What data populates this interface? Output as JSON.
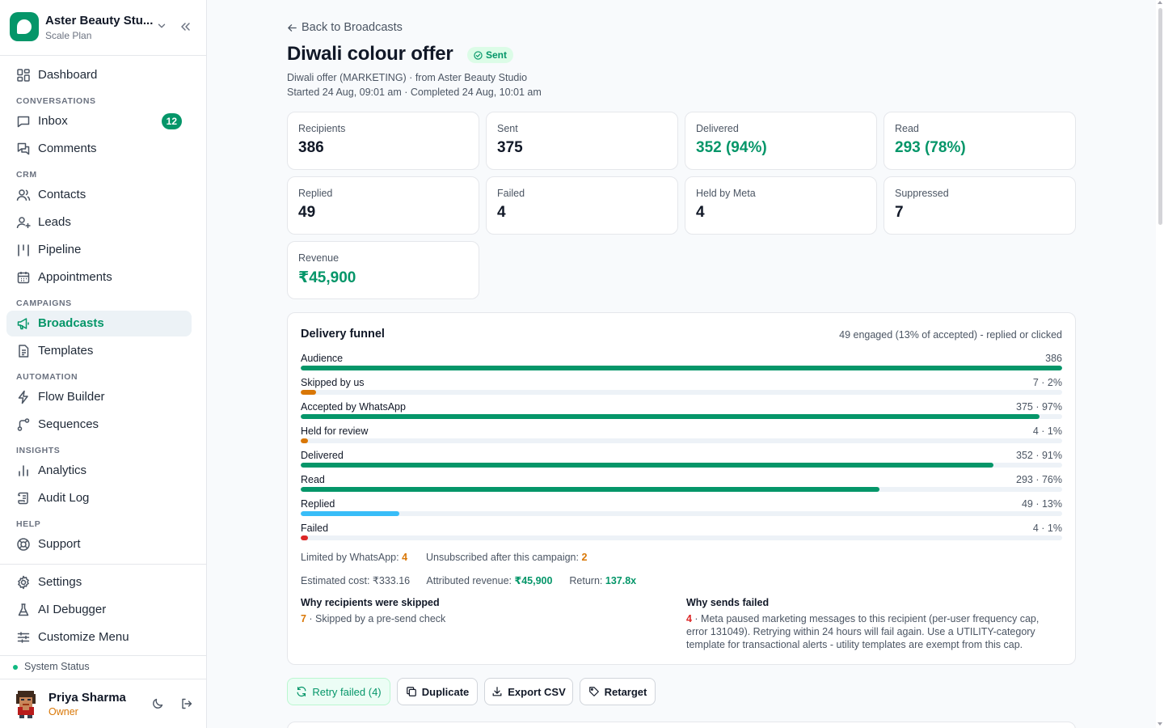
{
  "workspace": {
    "name": "Aster Beauty Stu...",
    "plan": "Scale Plan"
  },
  "sidebar": {
    "dashboard": "Dashboard",
    "sections": {
      "conversations": "CONVERSATIONS",
      "crm": "CRM",
      "campaigns": "CAMPAIGNS",
      "automation": "AUTOMATION",
      "insights": "INSIGHTS",
      "help": "HELP"
    },
    "items": {
      "inbox": "Inbox",
      "inbox_badge": "12",
      "comments": "Comments",
      "contacts": "Contacts",
      "leads": "Leads",
      "pipeline": "Pipeline",
      "appointments": "Appointments",
      "broadcasts": "Broadcasts",
      "templates": "Templates",
      "flow_builder": "Flow Builder",
      "sequences": "Sequences",
      "analytics": "Analytics",
      "audit_log": "Audit Log",
      "support": "Support",
      "settings": "Settings",
      "ai_debugger": "AI Debugger",
      "customize_menu": "Customize Menu"
    },
    "system_status": "System Status",
    "user": {
      "name": "Priya Sharma",
      "role": "Owner"
    }
  },
  "header": {
    "back": "Back to Broadcasts",
    "title": "Diwali colour offer",
    "status": "Sent",
    "meta1": "Diwali offer (MARKETING) · from Aster Beauty Studio",
    "meta2": "Started 24 Aug, 09:01 am · Completed 24 Aug, 10:01 am"
  },
  "stats": [
    {
      "label": "Recipients",
      "value": "386"
    },
    {
      "label": "Sent",
      "value": "375"
    },
    {
      "label": "Delivered",
      "value": "352 (94%)"
    },
    {
      "label": "Read",
      "value": "293 (78%)"
    },
    {
      "label": "Replied",
      "value": "49"
    },
    {
      "label": "Failed",
      "value": "4"
    },
    {
      "label": "Held by Meta",
      "value": "4"
    },
    {
      "label": "Suppressed",
      "value": "7"
    },
    {
      "label": "Revenue",
      "value": "₹45,900"
    }
  ],
  "funnel": {
    "title": "Delivery funnel",
    "subtitle": "49 engaged (13% of accepted) - replied or clicked",
    "rows": [
      {
        "label": "Audience",
        "value": "386",
        "fraction": 1.0,
        "color": "#059669"
      },
      {
        "label": "Skipped by us",
        "value": "7 · 2%",
        "fraction": 0.02,
        "color": "#d97706"
      },
      {
        "label": "Accepted by WhatsApp",
        "value": "375 · 97%",
        "fraction": 0.97,
        "color": "#059669"
      },
      {
        "label": "Held for review",
        "value": "4 · 1%",
        "fraction": 0.01,
        "color": "#d97706"
      },
      {
        "label": "Delivered",
        "value": "352 · 91%",
        "fraction": 0.91,
        "color": "#059669"
      },
      {
        "label": "Read",
        "value": "293 · 76%",
        "fraction": 0.76,
        "color": "#059669"
      },
      {
        "label": "Replied",
        "value": "49 · 13%",
        "fraction": 0.13,
        "color": "#38bdf8"
      },
      {
        "label": "Failed",
        "value": "4 · 1%",
        "fraction": 0.01,
        "color": "#dc2626"
      }
    ],
    "limited_label": "Limited by WhatsApp:",
    "limited_value": "4",
    "unsub_label": "Unsubscribed after this campaign:",
    "unsub_value": "2",
    "cost_label": "Estimated cost: ₹333.16",
    "revenue_label": "Attributed revenue:",
    "revenue_value": "₹45,900",
    "return_label": "Return:",
    "return_value": "137.8x",
    "skipped_title": "Why recipients were skipped",
    "skipped_count": "7",
    "skipped_text": " · Skipped by a pre-send check",
    "failed_title": "Why sends failed",
    "failed_count": "4",
    "failed_text": " · Meta paused marketing messages to this recipient (per-user frequency cap, error 131049). Retrying within 24 hours will fail again. Use a UTILITY-category template for transactional alerts - utility templates are exempt from this cap."
  },
  "actions": {
    "retry": "Retry failed (4)",
    "duplicate": "Duplicate",
    "export": "Export CSV",
    "retarget": "Retarget"
  }
}
